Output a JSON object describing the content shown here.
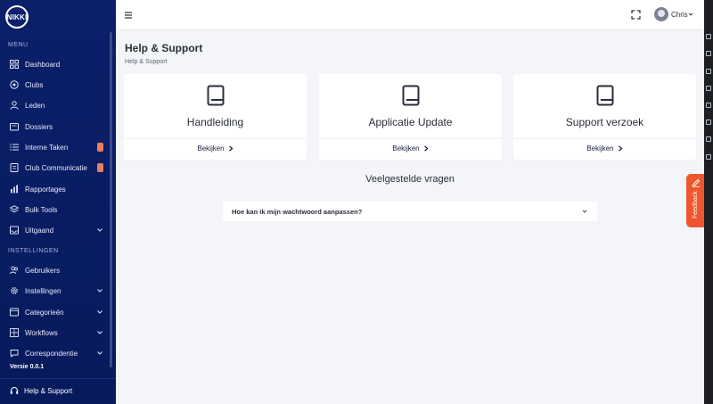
{
  "app": {
    "logo_text": "NIKKI",
    "version": "Versie 0.0.1"
  },
  "sidebar": {
    "menu_label": "MENU",
    "settings_label": "INSTELLINGEN",
    "menu_items": [
      {
        "label": "Dashboard",
        "icon": "grid-icon"
      },
      {
        "label": "Clubs",
        "icon": "club-icon"
      },
      {
        "label": "Leden",
        "icon": "user-icon"
      },
      {
        "label": "Dossiers",
        "icon": "folder-icon"
      },
      {
        "label": "Interne Taken",
        "icon": "list-icon",
        "badge": true
      },
      {
        "label": "Club Communicatie",
        "icon": "mail-icon",
        "badge": true
      },
      {
        "label": "Rapportages",
        "icon": "chart-icon"
      },
      {
        "label": "Bulk Tools",
        "icon": "layers-icon"
      },
      {
        "label": "Uitgaand",
        "icon": "inbox-icon",
        "expandable": true
      }
    ],
    "settings_items": [
      {
        "label": "Gebruikers",
        "icon": "users-icon"
      },
      {
        "label": "Instellingen",
        "icon": "gear-icon",
        "expandable": true
      },
      {
        "label": "Categorieën",
        "icon": "category-icon",
        "expandable": true
      },
      {
        "label": "Workflows",
        "icon": "workflow-icon",
        "expandable": true
      },
      {
        "label": "Correspondentie",
        "icon": "chat-icon",
        "expandable": true
      }
    ],
    "help_item": "Help & Support"
  },
  "topbar": {
    "username": "Chris"
  },
  "main": {
    "title": "Help & Support",
    "breadcrumb": "Help & Support",
    "cards": [
      {
        "title": "Handleiding",
        "link": "Bekijken"
      },
      {
        "title": "Applicatie Update",
        "link": "Bekijken"
      },
      {
        "title": "Support verzoek",
        "link": "Bekijken"
      }
    ],
    "faq_heading": "Veelgestelde vragen",
    "faq_items": [
      {
        "question": "Hoe kan ik mijn wachtwoord aanpassen?"
      }
    ]
  },
  "feedback": {
    "label": "Feedback"
  },
  "colors": {
    "sidebar": "#0b1f6b",
    "accent": "#f0562d",
    "badge": "#e8805d"
  }
}
